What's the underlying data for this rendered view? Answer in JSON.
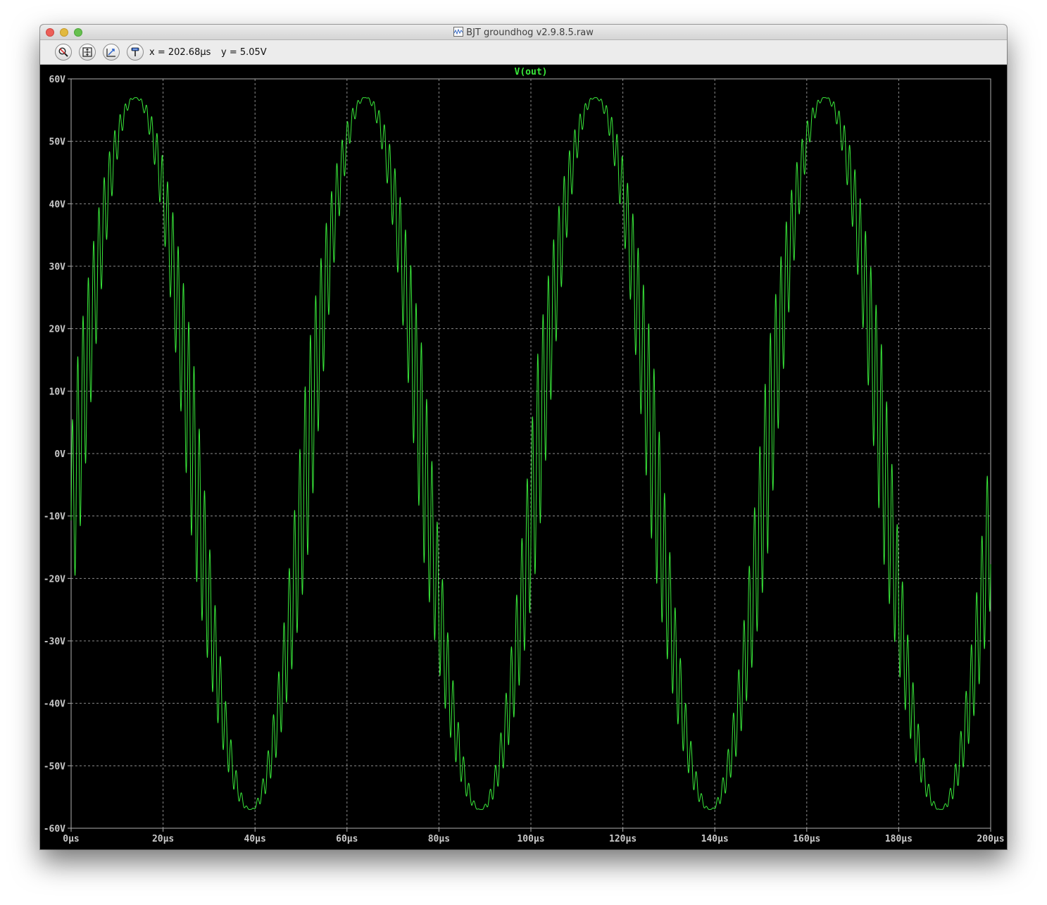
{
  "window": {
    "title": "BJT groundhog v2.9.8.5.raw"
  },
  "toolbar": {
    "buttons": [
      {
        "name": "zoom-icon"
      },
      {
        "name": "autorange-icon"
      },
      {
        "name": "pan-icon"
      },
      {
        "name": "probe-icon"
      }
    ],
    "cursor_x": "x = 202.68µs",
    "cursor_y": "y = 5.05V"
  },
  "colors": {
    "background": "#000000",
    "trace": "#39e83a",
    "grid": "#8a8a8a",
    "tick_text": "#c8c8c8",
    "title_text": "#39e83a"
  },
  "chart_data": {
    "type": "line",
    "title": "V(out)",
    "xlabel": "",
    "ylabel": "",
    "x_ticks": [
      "0µs",
      "20µs",
      "40µs",
      "60µs",
      "80µs",
      "100µs",
      "120µs",
      "140µs",
      "160µs",
      "180µs",
      "200µs"
    ],
    "y_ticks": [
      "60V",
      "50V",
      "40V",
      "30V",
      "20V",
      "10V",
      "0V",
      "-10V",
      "-20V",
      "-30V",
      "-40V",
      "-50V",
      "-60V"
    ],
    "xlim": [
      0,
      200
    ],
    "ylim": [
      -60,
      60
    ],
    "x_unit": "µs",
    "y_unit": "V",
    "grid": true,
    "series": [
      {
        "name": "V(out)",
        "carrier": {
          "amplitude_V": 57,
          "period_us": 50,
          "peak_at_us": 14
        },
        "ripple": {
          "amplitude_V": 16,
          "period_us": 1.15,
          "note": "ripple strongest near zero crossings, vanishing at peaks"
        },
        "samples": [
          {
            "x": 0,
            "y": -30
          },
          {
            "x": 4,
            "y": -5
          },
          {
            "x": 10,
            "y": 45
          },
          {
            "x": 14,
            "y": 57.5
          },
          {
            "x": 20,
            "y": 45
          },
          {
            "x": 27,
            "y": 10
          },
          {
            "x": 32,
            "y": -30
          },
          {
            "x": 39,
            "y": -57.5
          },
          {
            "x": 45,
            "y": -45
          },
          {
            "x": 52,
            "y": 10
          },
          {
            "x": 60,
            "y": 45
          },
          {
            "x": 64,
            "y": 57.5
          },
          {
            "x": 70,
            "y": 45
          },
          {
            "x": 77,
            "y": 10
          },
          {
            "x": 82,
            "y": -30
          },
          {
            "x": 89,
            "y": -57.5
          },
          {
            "x": 95,
            "y": -45
          },
          {
            "x": 102,
            "y": 10
          },
          {
            "x": 110,
            "y": 45
          },
          {
            "x": 114,
            "y": 57.5
          },
          {
            "x": 120,
            "y": 45
          },
          {
            "x": 127,
            "y": 10
          },
          {
            "x": 132,
            "y": -30
          },
          {
            "x": 139,
            "y": -57.5
          },
          {
            "x": 145,
            "y": -45
          },
          {
            "x": 152,
            "y": 10
          },
          {
            "x": 160,
            "y": 45
          },
          {
            "x": 164,
            "y": 57.5
          },
          {
            "x": 170,
            "y": 45
          },
          {
            "x": 177,
            "y": 10
          },
          {
            "x": 182,
            "y": -30
          },
          {
            "x": 189,
            "y": -57.5
          },
          {
            "x": 195,
            "y": -45
          },
          {
            "x": 200,
            "y": 0
          }
        ]
      }
    ]
  }
}
